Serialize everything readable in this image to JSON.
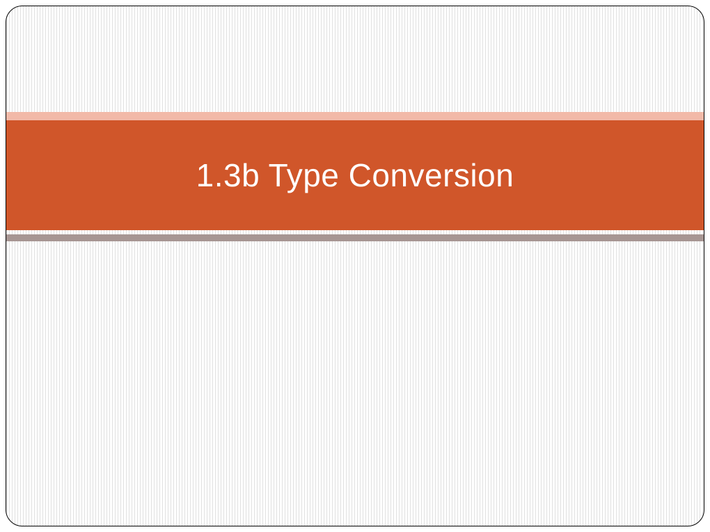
{
  "slide": {
    "title": "1.3b Type Conversion",
    "colors": {
      "title_bar": "#d0562a",
      "stripe_top": "#f2b9a8",
      "stripe_bottom": "#a79693"
    }
  }
}
